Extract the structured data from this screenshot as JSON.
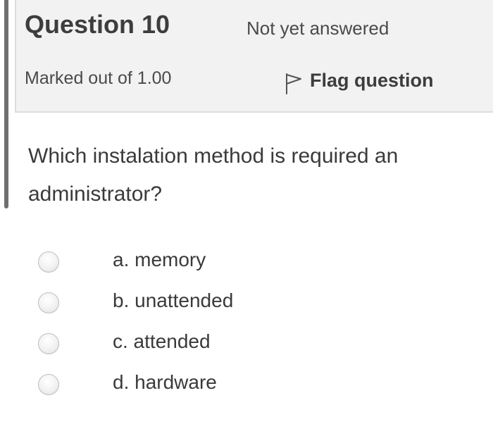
{
  "question": {
    "title": "Question 10",
    "state": "Not yet answered",
    "grade": "Marked out of 1.00",
    "flag_label": "Flag question",
    "flag_icon": "flag-outline-icon",
    "text": "Which instalation method is required an administrator?"
  },
  "answers": [
    {
      "label": "a. memory",
      "selected": false
    },
    {
      "label": "b. unattended",
      "selected": false
    },
    {
      "label": "c. attended",
      "selected": false
    },
    {
      "label": "d. hardware",
      "selected": false
    }
  ]
}
